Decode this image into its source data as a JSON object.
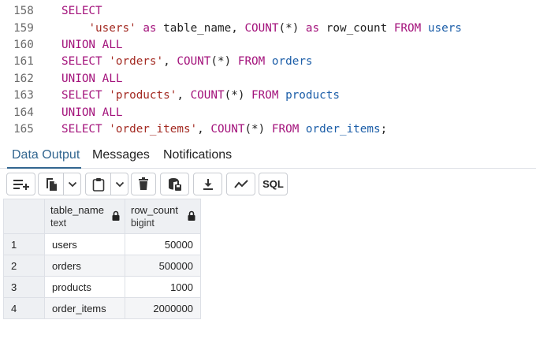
{
  "editor": {
    "lines": [
      {
        "num": "158",
        "tokens": [
          {
            "t": "SELECT",
            "c": "kw"
          }
        ]
      },
      {
        "num": "159",
        "tokens": [
          {
            "t": "    ",
            "c": "pn"
          },
          {
            "t": "'users'",
            "c": "str"
          },
          {
            "t": " ",
            "c": "pn"
          },
          {
            "t": "as",
            "c": "kw"
          },
          {
            "t": " table_name, ",
            "c": "id"
          },
          {
            "t": "COUNT",
            "c": "kw"
          },
          {
            "t": "(*) ",
            "c": "pn"
          },
          {
            "t": "as",
            "c": "kw"
          },
          {
            "t": " row_count ",
            "c": "id"
          },
          {
            "t": "FROM",
            "c": "kw"
          },
          {
            "t": " ",
            "c": "pn"
          },
          {
            "t": "users",
            "c": "tbl"
          }
        ]
      },
      {
        "num": "160",
        "tokens": [
          {
            "t": "UNION ALL",
            "c": "kw"
          }
        ]
      },
      {
        "num": "161",
        "tokens": [
          {
            "t": "SELECT",
            "c": "kw"
          },
          {
            "t": " ",
            "c": "pn"
          },
          {
            "t": "'orders'",
            "c": "str"
          },
          {
            "t": ", ",
            "c": "pn"
          },
          {
            "t": "COUNT",
            "c": "kw"
          },
          {
            "t": "(*) ",
            "c": "pn"
          },
          {
            "t": "FROM",
            "c": "kw"
          },
          {
            "t": " ",
            "c": "pn"
          },
          {
            "t": "orders",
            "c": "tbl"
          }
        ]
      },
      {
        "num": "162",
        "tokens": [
          {
            "t": "UNION ALL",
            "c": "kw"
          }
        ]
      },
      {
        "num": "163",
        "tokens": [
          {
            "t": "SELECT",
            "c": "kw"
          },
          {
            "t": " ",
            "c": "pn"
          },
          {
            "t": "'products'",
            "c": "str"
          },
          {
            "t": ", ",
            "c": "pn"
          },
          {
            "t": "COUNT",
            "c": "kw"
          },
          {
            "t": "(*) ",
            "c": "pn"
          },
          {
            "t": "FROM",
            "c": "kw"
          },
          {
            "t": " ",
            "c": "pn"
          },
          {
            "t": "products",
            "c": "tbl"
          }
        ]
      },
      {
        "num": "164",
        "tokens": [
          {
            "t": "UNION ALL",
            "c": "kw"
          }
        ]
      },
      {
        "num": "165",
        "tokens": [
          {
            "t": "SELECT",
            "c": "kw"
          },
          {
            "t": " ",
            "c": "pn"
          },
          {
            "t": "'order_items'",
            "c": "str"
          },
          {
            "t": ", ",
            "c": "pn"
          },
          {
            "t": "COUNT",
            "c": "kw"
          },
          {
            "t": "(*) ",
            "c": "pn"
          },
          {
            "t": "FROM",
            "c": "kw"
          },
          {
            "t": " ",
            "c": "pn"
          },
          {
            "t": "order_items",
            "c": "tbl"
          },
          {
            "t": ";",
            "c": "pn"
          }
        ]
      }
    ]
  },
  "tabs": [
    {
      "label": "Data Output",
      "active": true
    },
    {
      "label": "Messages",
      "active": false
    },
    {
      "label": "Notifications",
      "active": false
    }
  ],
  "toolbar": {
    "buttons": [
      "add-row-icon",
      "copy-icon",
      "chevron-down-icon",
      "paste-icon",
      "chevron-down-icon",
      "delete-icon",
      "save-data-icon",
      "download-icon",
      "graph-icon"
    ],
    "sql_label": "SQL"
  },
  "grid": {
    "columns": [
      {
        "name": "table_name",
        "type": "text"
      },
      {
        "name": "row_count",
        "type": "bigint"
      }
    ],
    "rows": [
      {
        "num": "1",
        "table_name": "users",
        "row_count": "50000"
      },
      {
        "num": "2",
        "table_name": "orders",
        "row_count": "500000"
      },
      {
        "num": "3",
        "table_name": "products",
        "row_count": "1000"
      },
      {
        "num": "4",
        "table_name": "order_items",
        "row_count": "2000000"
      }
    ]
  },
  "colors": {
    "keyword": "#a3127b",
    "string": "#a32a22",
    "table": "#1c5ea8",
    "active_tab": "#326690",
    "header_bg": "#eef0f3"
  }
}
